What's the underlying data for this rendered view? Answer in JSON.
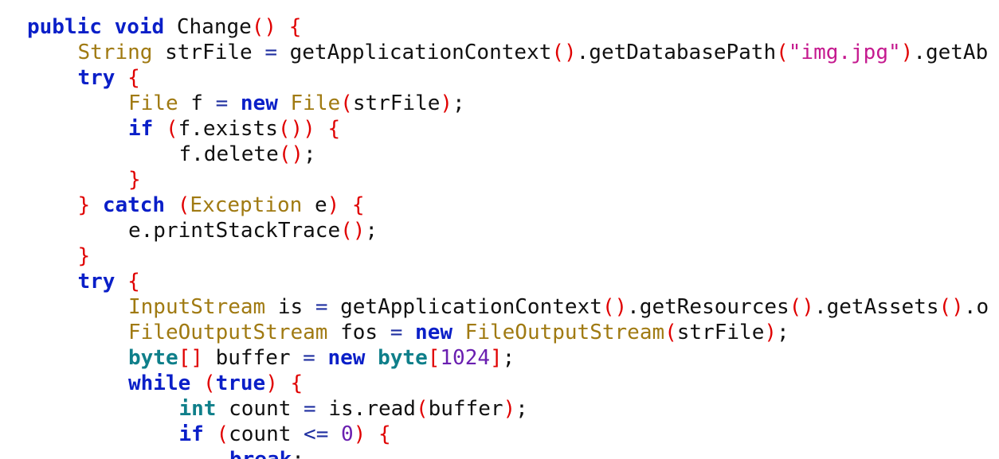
{
  "editor": {
    "theme": {
      "background": "#ffffff",
      "keyword": "#0a1fc8",
      "primitive_type": "#0f7f8a",
      "type_name": "#a07a12",
      "punctuation": "#e00000",
      "string": "#c51a8f",
      "number": "#6a1fb0",
      "operator": "#1f2fa0",
      "identifier": "#111111"
    },
    "lines": [
      {
        "indent": 0,
        "tokens": [
          {
            "t": "public",
            "c": "kw"
          },
          {
            "t": " ",
            "c": "id"
          },
          {
            "t": "void",
            "c": "kw"
          },
          {
            "t": " Change",
            "c": "id"
          },
          {
            "t": "()",
            "c": "pn"
          },
          {
            "t": " ",
            "c": "id"
          },
          {
            "t": "{",
            "c": "pn"
          }
        ]
      },
      {
        "indent": 1,
        "tokens": [
          {
            "t": "String",
            "c": "ty"
          },
          {
            "t": " strFile ",
            "c": "id"
          },
          {
            "t": "=",
            "c": "op"
          },
          {
            "t": " getApplicationContext",
            "c": "id"
          },
          {
            "t": "()",
            "c": "pn"
          },
          {
            "t": ".getDatabasePath",
            "c": "id"
          },
          {
            "t": "(",
            "c": "pn"
          },
          {
            "t": "\"img.jpg\"",
            "c": "str"
          },
          {
            "t": ")",
            "c": "pn"
          },
          {
            "t": ".getAb",
            "c": "id"
          }
        ]
      },
      {
        "indent": 1,
        "tokens": [
          {
            "t": "try",
            "c": "kw"
          },
          {
            "t": " ",
            "c": "id"
          },
          {
            "t": "{",
            "c": "pn"
          }
        ]
      },
      {
        "indent": 2,
        "tokens": [
          {
            "t": "File",
            "c": "ty"
          },
          {
            "t": " f ",
            "c": "id"
          },
          {
            "t": "=",
            "c": "op"
          },
          {
            "t": " ",
            "c": "id"
          },
          {
            "t": "new",
            "c": "kw"
          },
          {
            "t": " ",
            "c": "id"
          },
          {
            "t": "File",
            "c": "ty"
          },
          {
            "t": "(",
            "c": "pn"
          },
          {
            "t": "strFile",
            "c": "id"
          },
          {
            "t": ")",
            "c": "pn"
          },
          {
            "t": ";",
            "c": "id"
          }
        ]
      },
      {
        "indent": 2,
        "tokens": [
          {
            "t": "if",
            "c": "kw"
          },
          {
            "t": " ",
            "c": "id"
          },
          {
            "t": "(",
            "c": "pn"
          },
          {
            "t": "f.exists",
            "c": "id"
          },
          {
            "t": "())",
            "c": "pn"
          },
          {
            "t": " ",
            "c": "id"
          },
          {
            "t": "{",
            "c": "pn"
          }
        ]
      },
      {
        "indent": 3,
        "tokens": [
          {
            "t": "f.delete",
            "c": "id"
          },
          {
            "t": "()",
            "c": "pn"
          },
          {
            "t": ";",
            "c": "id"
          }
        ]
      },
      {
        "indent": 2,
        "tokens": [
          {
            "t": "}",
            "c": "pn"
          }
        ]
      },
      {
        "indent": 1,
        "tokens": [
          {
            "t": "}",
            "c": "pn"
          },
          {
            "t": " ",
            "c": "id"
          },
          {
            "t": "catch",
            "c": "kw"
          },
          {
            "t": " ",
            "c": "id"
          },
          {
            "t": "(",
            "c": "pn"
          },
          {
            "t": "Exception",
            "c": "ty"
          },
          {
            "t": " e",
            "c": "id"
          },
          {
            "t": ")",
            "c": "pn"
          },
          {
            "t": " ",
            "c": "id"
          },
          {
            "t": "{",
            "c": "pn"
          }
        ]
      },
      {
        "indent": 2,
        "tokens": [
          {
            "t": "e.printStackTrace",
            "c": "id"
          },
          {
            "t": "()",
            "c": "pn"
          },
          {
            "t": ";",
            "c": "id"
          }
        ]
      },
      {
        "indent": 1,
        "tokens": [
          {
            "t": "}",
            "c": "pn"
          }
        ]
      },
      {
        "indent": 1,
        "tokens": [
          {
            "t": "try",
            "c": "kw"
          },
          {
            "t": " ",
            "c": "id"
          },
          {
            "t": "{",
            "c": "pn"
          }
        ]
      },
      {
        "indent": 2,
        "tokens": [
          {
            "t": "InputStream",
            "c": "ty"
          },
          {
            "t": " is ",
            "c": "id"
          },
          {
            "t": "=",
            "c": "op"
          },
          {
            "t": " getApplicationContext",
            "c": "id"
          },
          {
            "t": "()",
            "c": "pn"
          },
          {
            "t": ".getResources",
            "c": "id"
          },
          {
            "t": "()",
            "c": "pn"
          },
          {
            "t": ".getAssets",
            "c": "id"
          },
          {
            "t": "()",
            "c": "pn"
          },
          {
            "t": ".o",
            "c": "id"
          }
        ]
      },
      {
        "indent": 2,
        "tokens": [
          {
            "t": "FileOutputStream",
            "c": "ty"
          },
          {
            "t": " fos ",
            "c": "id"
          },
          {
            "t": "=",
            "c": "op"
          },
          {
            "t": " ",
            "c": "id"
          },
          {
            "t": "new",
            "c": "kw"
          },
          {
            "t": " ",
            "c": "id"
          },
          {
            "t": "FileOutputStream",
            "c": "ty"
          },
          {
            "t": "(",
            "c": "pn"
          },
          {
            "t": "strFile",
            "c": "id"
          },
          {
            "t": ")",
            "c": "pn"
          },
          {
            "t": ";",
            "c": "id"
          }
        ]
      },
      {
        "indent": 2,
        "tokens": [
          {
            "t": "byte",
            "c": "prim"
          },
          {
            "t": "[]",
            "c": "pn"
          },
          {
            "t": " buffer ",
            "c": "id"
          },
          {
            "t": "=",
            "c": "op"
          },
          {
            "t": " ",
            "c": "id"
          },
          {
            "t": "new",
            "c": "kw"
          },
          {
            "t": " ",
            "c": "id"
          },
          {
            "t": "byte",
            "c": "prim"
          },
          {
            "t": "[",
            "c": "pn"
          },
          {
            "t": "1024",
            "c": "num"
          },
          {
            "t": "]",
            "c": "pn"
          },
          {
            "t": ";",
            "c": "id"
          }
        ]
      },
      {
        "indent": 2,
        "tokens": [
          {
            "t": "while",
            "c": "kw"
          },
          {
            "t": " ",
            "c": "id"
          },
          {
            "t": "(",
            "c": "pn"
          },
          {
            "t": "true",
            "c": "kw"
          },
          {
            "t": ")",
            "c": "pn"
          },
          {
            "t": " ",
            "c": "id"
          },
          {
            "t": "{",
            "c": "pn"
          }
        ]
      },
      {
        "indent": 3,
        "tokens": [
          {
            "t": "int",
            "c": "prim"
          },
          {
            "t": " count ",
            "c": "id"
          },
          {
            "t": "=",
            "c": "op"
          },
          {
            "t": " is.read",
            "c": "id"
          },
          {
            "t": "(",
            "c": "pn"
          },
          {
            "t": "buffer",
            "c": "id"
          },
          {
            "t": ")",
            "c": "pn"
          },
          {
            "t": ";",
            "c": "id"
          }
        ]
      },
      {
        "indent": 3,
        "tokens": [
          {
            "t": "if",
            "c": "kw"
          },
          {
            "t": " ",
            "c": "id"
          },
          {
            "t": "(",
            "c": "pn"
          },
          {
            "t": "count ",
            "c": "id"
          },
          {
            "t": "<=",
            "c": "op"
          },
          {
            "t": " ",
            "c": "id"
          },
          {
            "t": "0",
            "c": "num"
          },
          {
            "t": ")",
            "c": "pn"
          },
          {
            "t": " ",
            "c": "id"
          },
          {
            "t": "{",
            "c": "pn"
          }
        ]
      },
      {
        "indent": 4,
        "tokens": [
          {
            "t": "break",
            "c": "kw"
          },
          {
            "t": ";",
            "c": "id"
          }
        ]
      }
    ]
  }
}
